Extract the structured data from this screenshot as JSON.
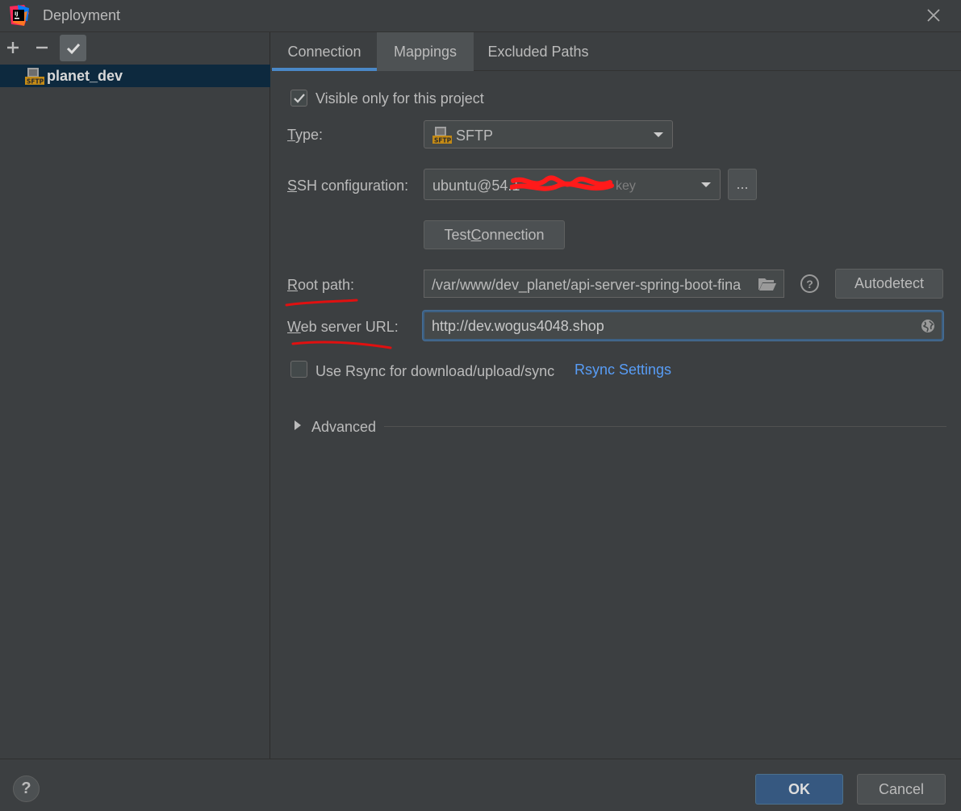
{
  "window": {
    "title": "Deployment"
  },
  "left_panel": {
    "toolbar": {
      "add_icon": "plus-icon",
      "remove_icon": "minus-icon",
      "default_icon": "checkmark-icon"
    },
    "servers": [
      {
        "name": "planet_dev",
        "icon": "sftp-icon",
        "selected": true
      }
    ]
  },
  "tabs": [
    {
      "label": "Connection",
      "active": true
    },
    {
      "label": "Mappings",
      "active": false
    },
    {
      "label": "Excluded Paths",
      "active": false
    }
  ],
  "connection": {
    "visible_only": {
      "label": "Visible only for this project",
      "checked": true
    },
    "type": {
      "label": "Type:",
      "value": "SFTP"
    },
    "ssh": {
      "label": "SSH configuration:",
      "value_visible": "ubuntu@54.1",
      "suffix": "key",
      "more_button": "..."
    },
    "test_connection": "Test Connection",
    "root_path": {
      "label": "Root path:",
      "value": "/var/www/dev_planet/api-server-spring-boot-fina",
      "autodetect": "Autodetect"
    },
    "web_server_url": {
      "label": "Web server URL:",
      "value": "http://dev.wogus4048.shop"
    },
    "rsync": {
      "label": "Use Rsync for download/upload/sync",
      "checked": false,
      "settings_link": "Rsync Settings"
    },
    "advanced": {
      "label": "Advanced",
      "expanded": false
    }
  },
  "footer": {
    "help": "?",
    "ok": "OK",
    "cancel": "Cancel"
  },
  "colors": {
    "background": "#3c3f41",
    "accent": "#4a88c7",
    "link": "#589df6",
    "ok_button": "#365880",
    "annotation": "#e01010"
  }
}
